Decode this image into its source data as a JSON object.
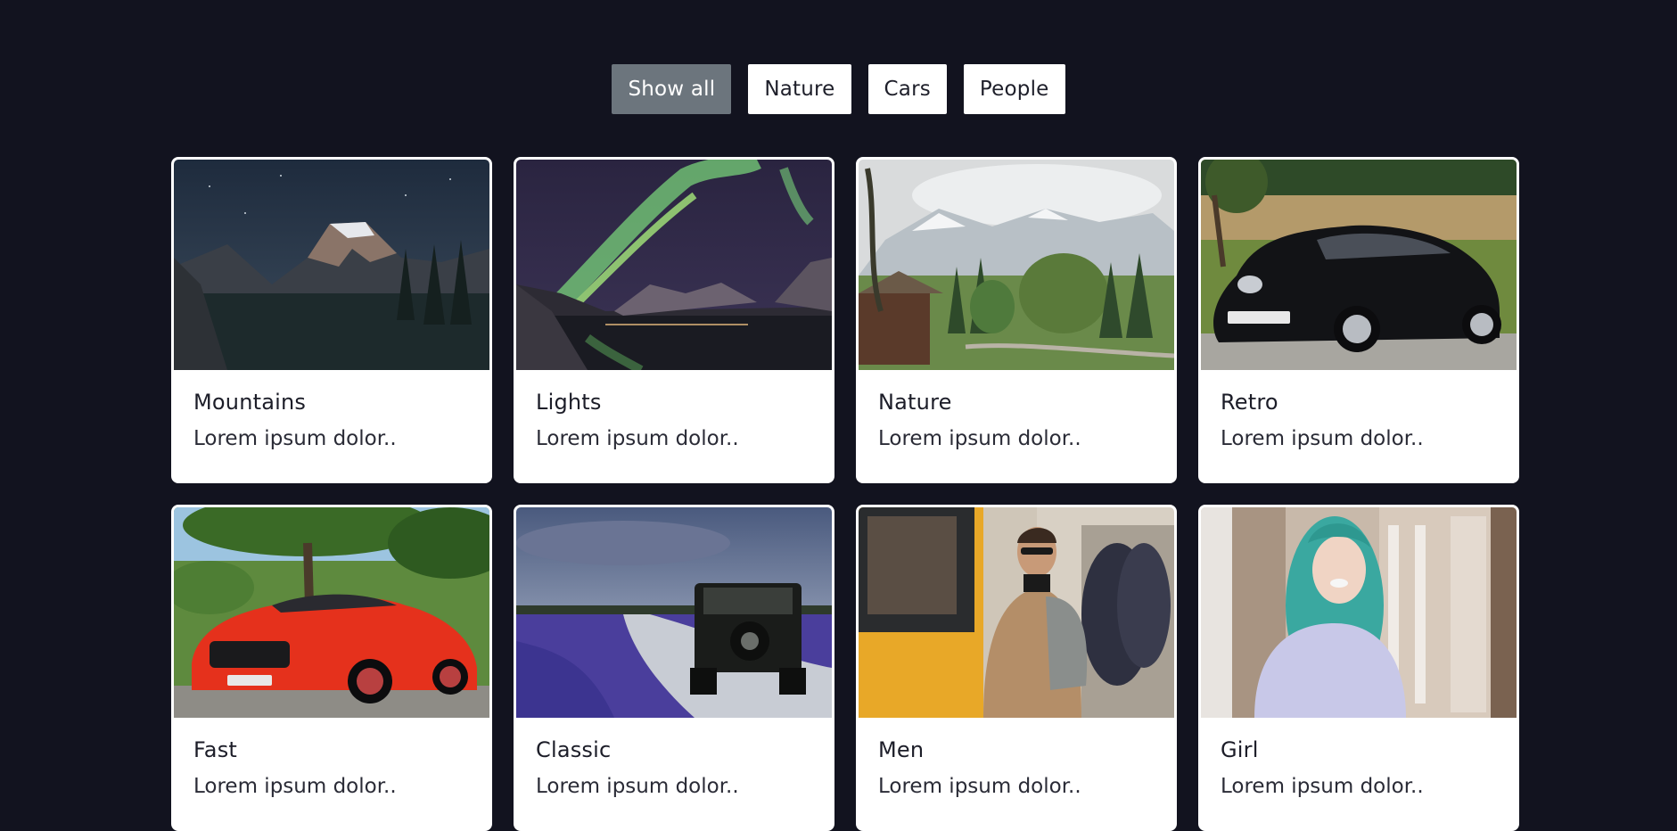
{
  "filters": [
    {
      "label": "Show all",
      "active": true
    },
    {
      "label": "Nature",
      "active": false
    },
    {
      "label": "Cars",
      "active": false
    },
    {
      "label": "People",
      "active": false
    }
  ],
  "cards": [
    {
      "title": "Mountains",
      "text": "Lorem ipsum dolor..",
      "image": "mountain-photo"
    },
    {
      "title": "Lights",
      "text": "Lorem ipsum dolor..",
      "image": "northern-lights-photo"
    },
    {
      "title": "Nature",
      "text": "Lorem ipsum dolor..",
      "image": "alpine-landscape-photo"
    },
    {
      "title": "Retro",
      "text": "Lorem ipsum dolor..",
      "image": "black-car-photo"
    },
    {
      "title": "Fast",
      "text": "Lorem ipsum dolor..",
      "image": "red-sports-car-photo"
    },
    {
      "title": "Classic",
      "text": "Lorem ipsum dolor..",
      "image": "offroad-jeep-photo"
    },
    {
      "title": "Men",
      "text": "Lorem ipsum dolor..",
      "image": "man-at-train-photo"
    },
    {
      "title": "Girl",
      "text": "Lorem ipsum dolor..",
      "image": "girl-portrait-photo"
    }
  ],
  "colors": {
    "background": "#12131f",
    "active_filter": "#6c757d",
    "card": "#ffffff"
  }
}
